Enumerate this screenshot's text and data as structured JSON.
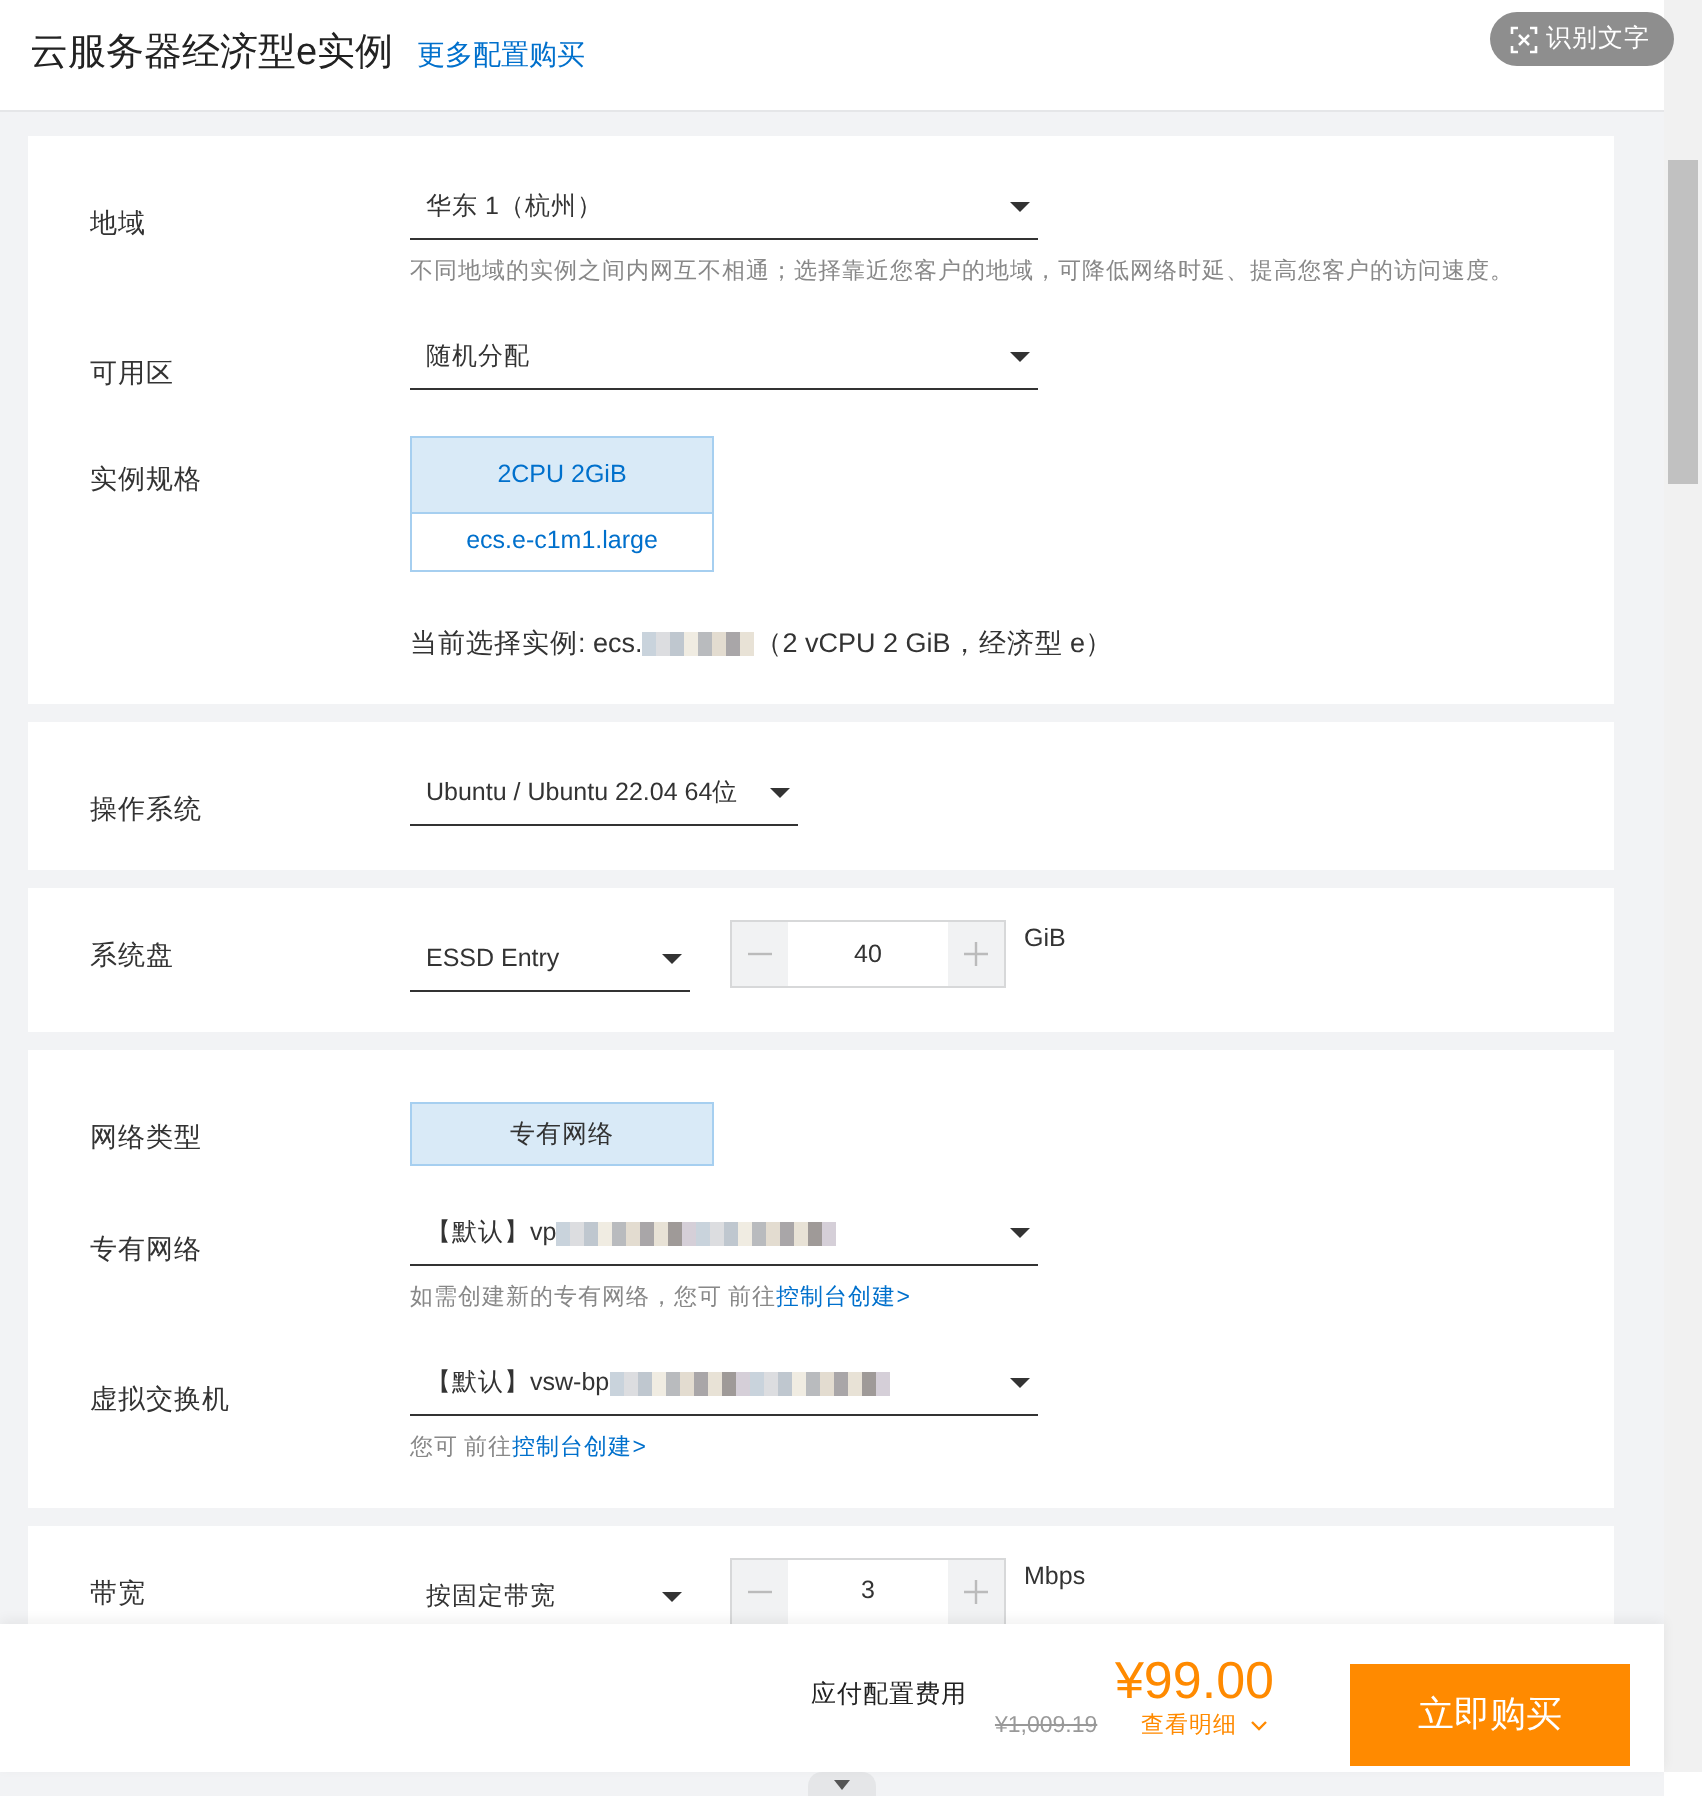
{
  "header": {
    "title": "云服务器经济型e实例",
    "link": "更多配置购买"
  },
  "ocr_button": {
    "label": "识别文字"
  },
  "sections": [
    {
      "rows": [
        {
          "kind": "select",
          "label": "地域",
          "value": "华东 1（杭州）",
          "hint": {
            "text": "不同地域的实例之间内网互不相通；选择靠近您客户的地域，可降低网络时延、提高您客户的访问速度。"
          }
        },
        {
          "kind": "select",
          "label": "可用区",
          "value": "随机分配"
        },
        {
          "kind": "spec",
          "label": "实例规格",
          "options": [
            {
              "title": "2CPU 2GiB",
              "subtitle": "ecs.e-c1m1.large",
              "selected": true
            }
          ],
          "current": {
            "prefix": "当前选择实例: ecs.",
            "suffix": "（2 vCPU 2 GiB，经济型 e）",
            "redacted": true
          }
        }
      ]
    },
    {
      "rows": [
        {
          "kind": "short-select",
          "label": "操作系统",
          "value": "Ubuntu / Ubuntu 22.04 64位"
        }
      ]
    },
    {
      "rows": [
        {
          "kind": "stepper",
          "label": "系统盘",
          "value": "ESSD Entry",
          "amount": "40",
          "unit": "GiB"
        }
      ]
    },
    {
      "rows": [
        {
          "kind": "choice",
          "label": "网络类型",
          "options": [
            {
              "label": "专有网络",
              "selected": true
            }
          ]
        },
        {
          "kind": "select",
          "label": "专有网络",
          "value": "【默认】vp",
          "redacted": true,
          "hint": {
            "text": "如需创建新的专有网络，您可 前往",
            "link": "控制台创建>"
          }
        },
        {
          "kind": "select",
          "label": "虚拟交换机",
          "value": "【默认】vsw-bp",
          "redacted": true,
          "hint": {
            "text": "您可 前往",
            "link": "控制台创建>"
          }
        }
      ]
    },
    {
      "rows": [
        {
          "kind": "stepper",
          "label": "带宽",
          "value": "按固定带宽",
          "amount": "3",
          "unit": "Mbps"
        }
      ]
    }
  ],
  "footer": {
    "cost_label": "应付配置费用",
    "price": "¥99.00",
    "original_price": "¥1,009.19",
    "details_link": "查看明细",
    "buy_button": "立即购买"
  }
}
